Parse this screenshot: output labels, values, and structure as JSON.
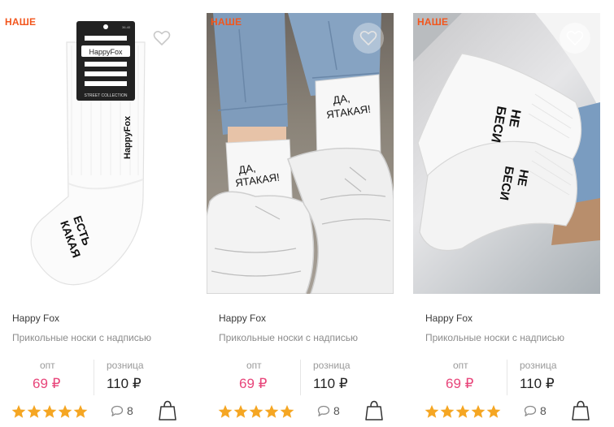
{
  "products": [
    {
      "badge": "НАШЕ",
      "brand": "Happy Fox",
      "description": "Прикольные носки с надписью",
      "price_opt_label": "опт",
      "price_opt": "69 ₽",
      "price_retail_label": "розница",
      "price_retail": "110 ₽",
      "rating": 5,
      "reviews_count": "8",
      "image": {
        "package_brand": "HappyFox",
        "package_collection": "STREET COLLECTION",
        "package_size": "36-40",
        "sock_brand": "HappyFox",
        "sock_text_line1": "КАКАЯ",
        "sock_text_line2": "ЕСТЬ"
      }
    },
    {
      "badge": "НАШЕ",
      "brand": "Happy Fox",
      "description": "Прикольные носки с надписью",
      "price_opt_label": "опт",
      "price_opt": "69 ₽",
      "price_retail_label": "розница",
      "price_retail": "110 ₽",
      "rating": 5,
      "reviews_count": "8",
      "image": {
        "sock_text_line1": "ДА,",
        "sock_text_line2": "ЯТАКАЯ!"
      }
    },
    {
      "badge": "НАШЕ",
      "brand": "Happy Fox",
      "description": "Прикольные носки с надписью",
      "price_opt_label": "опт",
      "price_opt": "69 ₽",
      "price_retail_label": "розница",
      "price_retail": "110 ₽",
      "rating": 5,
      "reviews_count": "8",
      "image": {
        "sock_text_line1": "НЕ",
        "sock_text_line2": "БЕСИ",
        "sock2_text_line1": "НЕ",
        "sock2_text_line2": "БЕСИ"
      }
    }
  ],
  "colors": {
    "badge": "#f2561d",
    "price_opt": "#e8457a",
    "star": "#f5a623",
    "text_muted": "#8c8c8c"
  },
  "icons": {
    "favorite": "heart-outline-icon",
    "reviews": "speech-bubble-icon",
    "cart": "shopping-bag-icon",
    "rating": "star-icon"
  }
}
